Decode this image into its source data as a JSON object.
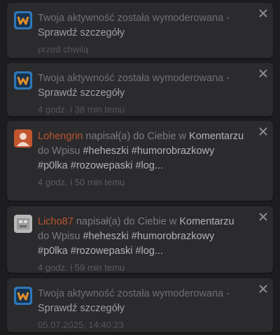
{
  "notifications": [
    {
      "kind": "moderation",
      "text": "Twoja aktywność została wymoderowana - ",
      "link": "Sprawdź szczegóły",
      "time": "przed chwilą"
    },
    {
      "kind": "moderation",
      "text": "Twoja aktywność została wymoderowana - ",
      "link": "Sprawdź szczegóły",
      "time": "4 godz. i 38 min temu"
    },
    {
      "kind": "mention",
      "user": "Lohengrin",
      "mid1": " napisał(a) do Ciebie w ",
      "target": "Komentarzu",
      "mid2": " do Wpisu ",
      "tags": "#heheszki #humorobrazkowy #p0lka #rozowepaski #log...",
      "time": "4 godz. i 50 min temu"
    },
    {
      "kind": "mention",
      "user": "Licho87",
      "mid1": " napisał(a) do Ciebie w ",
      "target": "Komentarzu",
      "mid2": " do Wpisu ",
      "tags": "#heheszki #humorobrazkowy #p0lka #rozowepaski #log...",
      "time": "4 godz. i 59 min temu"
    },
    {
      "kind": "moderation",
      "text": "Twoja aktywność została wymoderowana - ",
      "link": "Sprawdź szczegóły",
      "time": "05.07.2025, 14:40:23"
    }
  ],
  "icons": {
    "moderation": "wykop-logo-icon",
    "mention_1": "default-user-avatar-icon",
    "mention_2": "user-avatar-icon",
    "close": "close-icon"
  },
  "colors": {
    "background": "#1d1d1f",
    "card": "#2b2b2d",
    "username": "#b9542f",
    "logo_bg": "#2e77b8",
    "logo_fg": "#e28e27"
  }
}
